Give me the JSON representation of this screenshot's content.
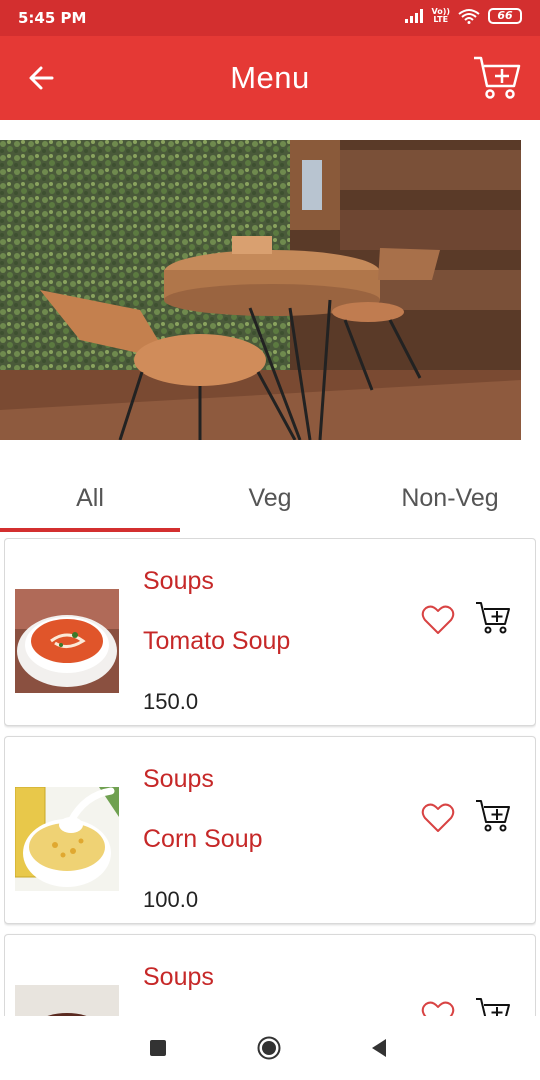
{
  "status_bar": {
    "time": "5:45 PM",
    "volte_top": "Vo))",
    "volte_bottom": "LTE",
    "battery": "66"
  },
  "app_bar": {
    "title": "Menu",
    "back_icon": "arrow-left-icon",
    "cart_icon": "cart-add-icon"
  },
  "tabs": [
    {
      "label": "All",
      "selected": true
    },
    {
      "label": "Veg",
      "selected": false
    },
    {
      "label": "Non-Veg",
      "selected": false
    }
  ],
  "items": [
    {
      "category": "Soups",
      "name": "Tomato Soup",
      "price": "150.0"
    },
    {
      "category": "Soups",
      "name": "Corn Soup",
      "price": "100.0"
    },
    {
      "category": "Soups",
      "name": "",
      "price": ""
    }
  ],
  "colors": {
    "status_bar": "#d32f2f",
    "app_bar": "#e53935",
    "accent": "#c62828"
  }
}
